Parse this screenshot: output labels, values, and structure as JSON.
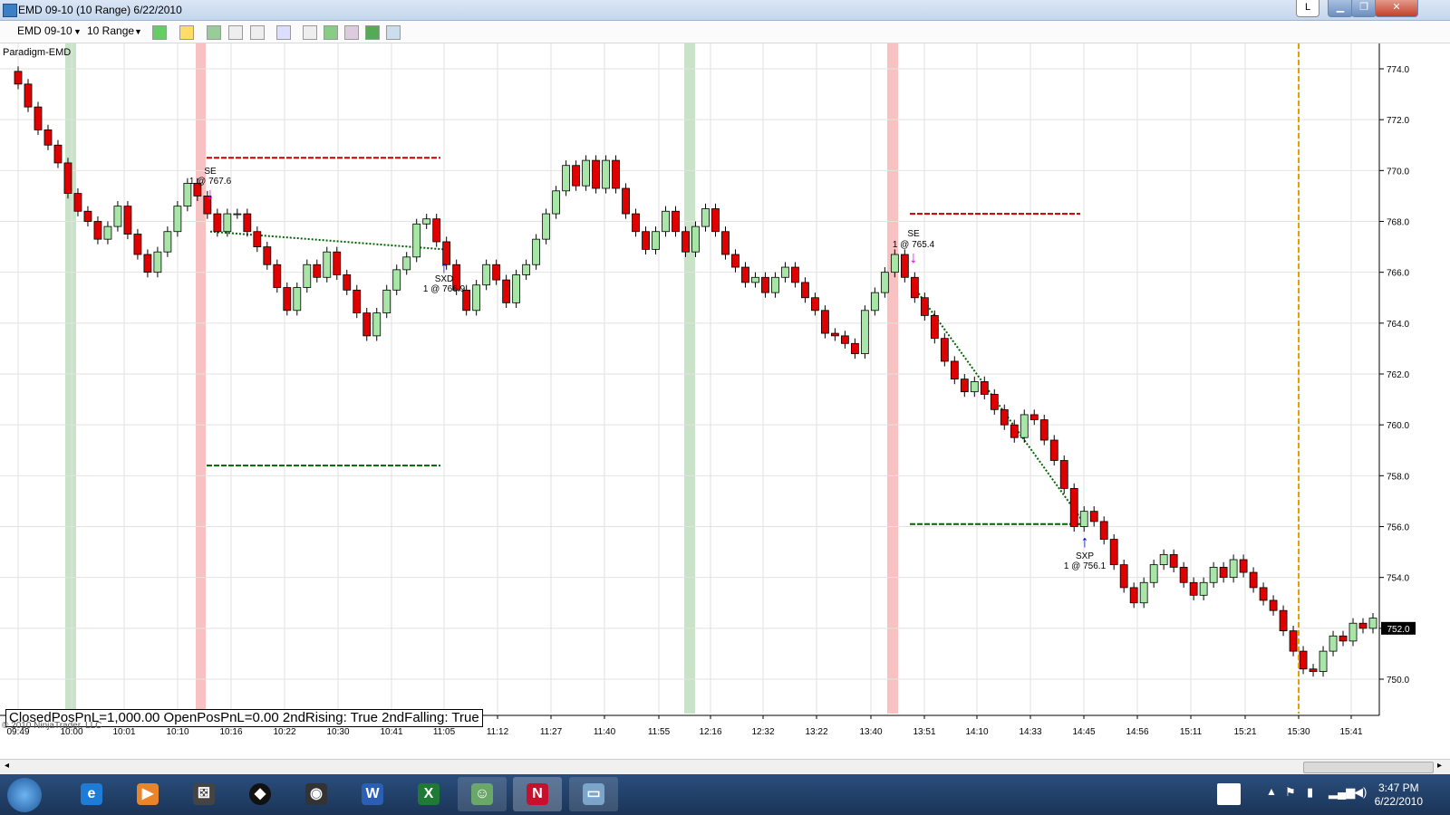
{
  "window": {
    "title": "EMD 09-10 (10 Range)  6/22/2010",
    "lang": "L",
    "min": "▁",
    "max": "❐",
    "close": "✕"
  },
  "toolbar": {
    "instrument": "EMD 09-10",
    "interval": "10 Range"
  },
  "chart": {
    "instrument_label": "Paradigm-EMD",
    "copyright": "© 2010 NinjaTrader, LLC",
    "pnl_text": "ClosedPosPnL=1,000.00 OpenPosPnL=0.00 2ndRising: True 2ndFalling: True",
    "price_badge": "752.0"
  },
  "chart_data": {
    "type": "candlestick",
    "y_ticks": [
      "774.0",
      "772.0",
      "770.0",
      "768.0",
      "766.0",
      "764.0",
      "762.0",
      "760.0",
      "758.0",
      "756.0",
      "754.0",
      "752.0",
      "750.0"
    ],
    "ylim": [
      749.5,
      774.5
    ],
    "x_ticks": [
      "09:49",
      "10:00",
      "10:01",
      "10:10",
      "10:16",
      "10:22",
      "10:30",
      "10:41",
      "11:05",
      "11:12",
      "11:27",
      "11:40",
      "11:55",
      "12:16",
      "12:32",
      "13:22",
      "13:40",
      "13:51",
      "14:10",
      "14:33",
      "14:45",
      "14:56",
      "15:11",
      "15:21",
      "15:30",
      "15:41"
    ],
    "closes": [
      773.4,
      772.5,
      771.6,
      771.0,
      770.3,
      769.1,
      768.4,
      768.0,
      767.3,
      767.8,
      768.6,
      767.5,
      766.7,
      766.0,
      766.8,
      767.6,
      768.6,
      769.5,
      769.0,
      768.3,
      767.6,
      768.3,
      768.3,
      767.6,
      767.0,
      766.3,
      765.4,
      764.5,
      765.4,
      766.3,
      765.8,
      766.8,
      765.9,
      765.3,
      764.4,
      763.5,
      764.4,
      765.3,
      766.1,
      766.6,
      767.9,
      768.1,
      767.2,
      766.3,
      765.3,
      764.5,
      765.5,
      766.3,
      765.7,
      764.8,
      765.9,
      766.3,
      767.3,
      768.3,
      769.2,
      770.2,
      769.4,
      770.4,
      769.3,
      770.4,
      769.3,
      768.3,
      767.6,
      766.9,
      767.6,
      768.4,
      767.6,
      766.8,
      767.8,
      768.5,
      767.6,
      766.7,
      766.2,
      765.6,
      765.8,
      765.2,
      765.8,
      766.2,
      765.6,
      765.0,
      764.5,
      763.6,
      763.5,
      763.2,
      762.8,
      764.5,
      765.2,
      766.0,
      766.7,
      765.8,
      765.0,
      764.3,
      763.4,
      762.5,
      761.8,
      761.3,
      761.7,
      761.2,
      760.6,
      760.0,
      759.5,
      760.4,
      760.2,
      759.4,
      758.6,
      757.5,
      756.0,
      756.6,
      756.2,
      755.5,
      754.5,
      753.6,
      753.0,
      753.8,
      754.5,
      754.9,
      754.4,
      753.8,
      753.3,
      753.8,
      754.4,
      754.0,
      754.7,
      754.2,
      753.6,
      753.1,
      752.7,
      751.9,
      751.1,
      750.4,
      750.3,
      751.1,
      751.7,
      751.5,
      752.2,
      752.0,
      752.4
    ]
  },
  "annotations": {
    "se1": "SE",
    "se1_fill": "1 @ 767.6",
    "sxd": "SXD",
    "sxd_fill": "1 @ 766.9",
    "se2": "SE",
    "se2_fill": "1 @ 765.4",
    "sxp": "SXP",
    "sxp_fill": "1 @ 756.1"
  },
  "taskbar": {
    "time": "3:47 PM",
    "date": "6/22/2010"
  }
}
